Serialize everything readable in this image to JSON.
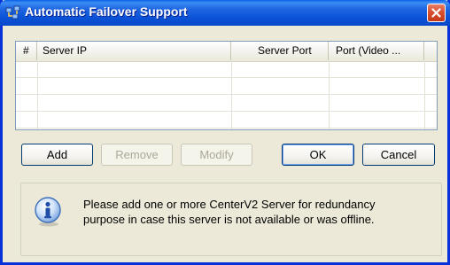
{
  "window": {
    "title": "Automatic Failover Support",
    "icons": {
      "app": "network-servers-icon",
      "close": "close-x-icon"
    }
  },
  "grid": {
    "columns": [
      "#",
      "Server IP",
      "Server Port",
      "Port (Video ..."
    ],
    "rows": []
  },
  "buttons": {
    "add": "Add",
    "remove": "Remove",
    "modify": "Modify",
    "ok": "OK",
    "cancel": "Cancel"
  },
  "info": {
    "icon": "info-icon",
    "line1": "Please add one or more CenterV2 Server for redundancy",
    "line2": "purpose in case this server is not available or was offline."
  },
  "colors": {
    "titlebar": "#0B52D6",
    "window_bg": "#ECE9D8",
    "close": "#D8502F",
    "info_icon": "#2E6FC6"
  }
}
